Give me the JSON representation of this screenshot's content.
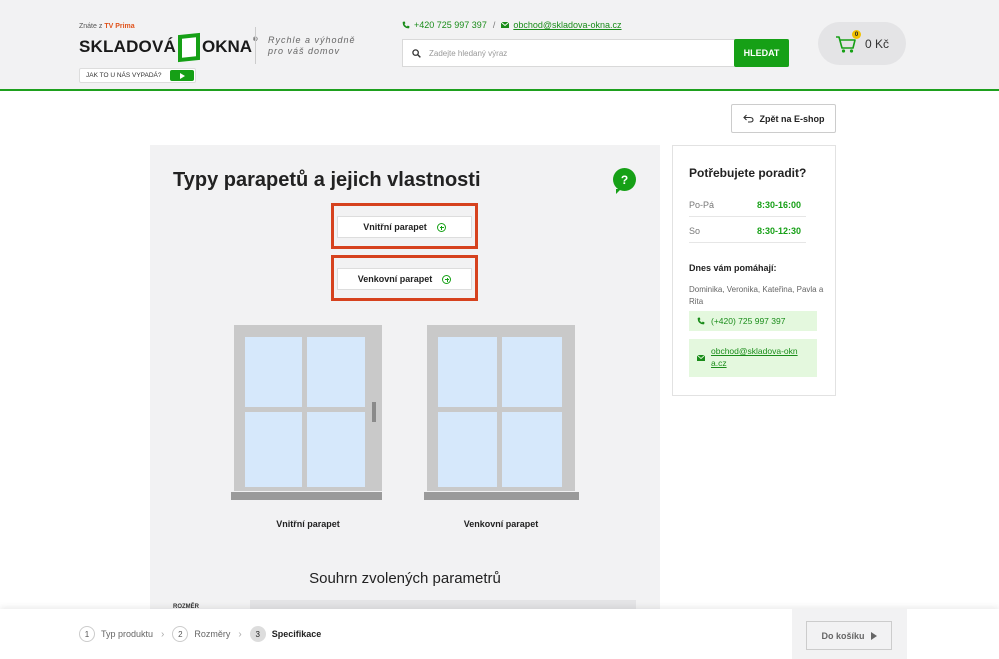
{
  "header": {
    "tv_prefix": "Znáte z",
    "tv_brand": "TV Prima",
    "logo_left": "SKLADOVÁ",
    "logo_right": "OKNA",
    "logo_reg": "®",
    "slogan_line1": "Rychle a výhodně",
    "slogan_line2": "pro váš domov",
    "jak_button": "JAK TO U NÁS VYPADÁ?",
    "phone": "+420 725 997 397",
    "separator": "/",
    "email": "obchod@skladova-okna.cz",
    "search_placeholder": "Zadejte hledaný výraz",
    "search_button": "HLEDAT",
    "cart_amount": "0 Kč",
    "cart_count": "0"
  },
  "back_button": "Zpět na E-shop",
  "main": {
    "title": "Typy parapetů a jejich vlastnosti",
    "help_icon": "?",
    "options": [
      {
        "label": "Vnitřní parapet",
        "icon": "plus-circle-icon"
      },
      {
        "label": "Venkovní parapet",
        "icon": "plus-circle-icon"
      }
    ],
    "windows": [
      {
        "label": "Vnitřní parapet"
      },
      {
        "label": "Venkovní parapet"
      }
    ],
    "summary_title": "Souhrn zvolených parametrů",
    "summary_first_label": "ROZMĚR"
  },
  "sidebar": {
    "title": "Potřebujete poradit?",
    "hours": [
      {
        "day": "Po-Pá",
        "time": "8:30-16:00"
      },
      {
        "day": "So",
        "time": "8:30-12:30"
      }
    ],
    "help_title": "Dnes vám pomáhají:",
    "names": "Dominika, Veronika, Kateřina, Pavla a Rita",
    "phone": "(+420) 725 997 397",
    "email": "obchod@skladova-okna.cz"
  },
  "steps": [
    {
      "num": "1",
      "label": "Typ produktu",
      "active": false
    },
    {
      "num": "2",
      "label": "Rozměry",
      "active": false
    },
    {
      "num": "3",
      "label": "Specifikace",
      "active": true
    }
  ],
  "cart_button": "Do košíku",
  "colors": {
    "brand_green": "#16a016",
    "highlight_red": "#d6421e",
    "panel_gray": "#f2f2f3",
    "window_glass": "#d6e8fb",
    "window_frame": "#c9c9c9"
  }
}
